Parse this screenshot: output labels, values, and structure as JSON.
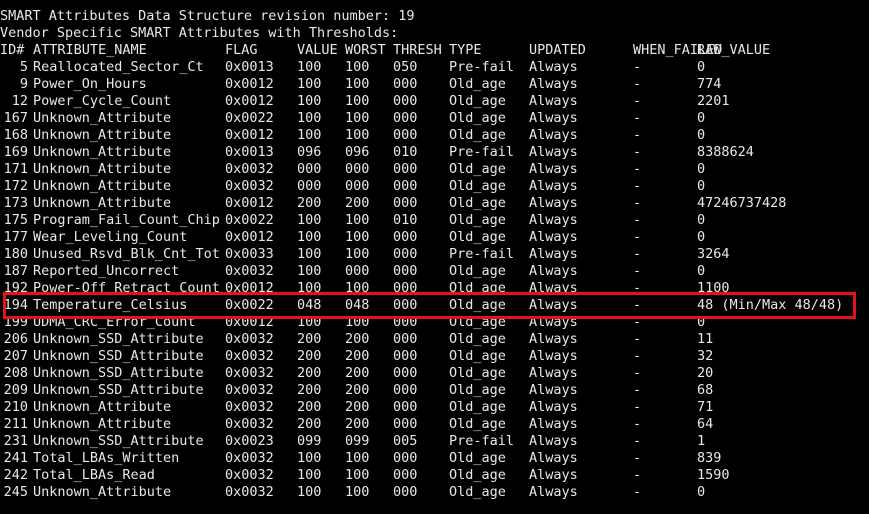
{
  "header_lines": [
    "SMART Attributes Data Structure revision number: 19",
    "Vendor Specific SMART Attributes with Thresholds:"
  ],
  "columns": {
    "id": "ID#",
    "name": "ATTRIBUTE_NAME",
    "flag": "FLAG",
    "value": "VALUE",
    "worst": "WORST",
    "thresh": "THRESH",
    "type": "TYPE",
    "updated": "UPDATED",
    "when_failed": "WHEN_FAILED",
    "raw": "RAW_VALUE"
  },
  "rows": [
    {
      "id": "5",
      "name": "Reallocated_Sector_Ct",
      "flag": "0x0013",
      "value": "100",
      "worst": "100",
      "thresh": "050",
      "type": "Pre-fail",
      "updated": "Always",
      "when_failed": "-",
      "raw": "0"
    },
    {
      "id": "9",
      "name": "Power_On_Hours",
      "flag": "0x0012",
      "value": "100",
      "worst": "100",
      "thresh": "000",
      "type": "Old_age",
      "updated": "Always",
      "when_failed": "-",
      "raw": "774"
    },
    {
      "id": "12",
      "name": "Power_Cycle_Count",
      "flag": "0x0012",
      "value": "100",
      "worst": "100",
      "thresh": "000",
      "type": "Old_age",
      "updated": "Always",
      "when_failed": "-",
      "raw": "2201"
    },
    {
      "id": "167",
      "name": "Unknown_Attribute",
      "flag": "0x0022",
      "value": "100",
      "worst": "100",
      "thresh": "000",
      "type": "Old_age",
      "updated": "Always",
      "when_failed": "-",
      "raw": "0"
    },
    {
      "id": "168",
      "name": "Unknown_Attribute",
      "flag": "0x0012",
      "value": "100",
      "worst": "100",
      "thresh": "000",
      "type": "Old_age",
      "updated": "Always",
      "when_failed": "-",
      "raw": "0"
    },
    {
      "id": "169",
      "name": "Unknown_Attribute",
      "flag": "0x0013",
      "value": "096",
      "worst": "096",
      "thresh": "010",
      "type": "Pre-fail",
      "updated": "Always",
      "when_failed": "-",
      "raw": "8388624"
    },
    {
      "id": "171",
      "name": "Unknown_Attribute",
      "flag": "0x0032",
      "value": "000",
      "worst": "000",
      "thresh": "000",
      "type": "Old_age",
      "updated": "Always",
      "when_failed": "-",
      "raw": "0"
    },
    {
      "id": "172",
      "name": "Unknown_Attribute",
      "flag": "0x0032",
      "value": "000",
      "worst": "000",
      "thresh": "000",
      "type": "Old_age",
      "updated": "Always",
      "when_failed": "-",
      "raw": "0"
    },
    {
      "id": "173",
      "name": "Unknown_Attribute",
      "flag": "0x0012",
      "value": "200",
      "worst": "200",
      "thresh": "000",
      "type": "Old_age",
      "updated": "Always",
      "when_failed": "-",
      "raw": "47246737428"
    },
    {
      "id": "175",
      "name": "Program_Fail_Count_Chip",
      "flag": "0x0022",
      "value": "100",
      "worst": "100",
      "thresh": "010",
      "type": "Old_age",
      "updated": "Always",
      "when_failed": "-",
      "raw": "0"
    },
    {
      "id": "177",
      "name": "Wear_Leveling_Count",
      "flag": "0x0012",
      "value": "100",
      "worst": "100",
      "thresh": "000",
      "type": "Old_age",
      "updated": "Always",
      "when_failed": "-",
      "raw": "0"
    },
    {
      "id": "180",
      "name": "Unused_Rsvd_Blk_Cnt_Tot",
      "flag": "0x0033",
      "value": "100",
      "worst": "100",
      "thresh": "000",
      "type": "Pre-fail",
      "updated": "Always",
      "when_failed": "-",
      "raw": "3264"
    },
    {
      "id": "187",
      "name": "Reported_Uncorrect",
      "flag": "0x0032",
      "value": "100",
      "worst": "000",
      "thresh": "000",
      "type": "Old_age",
      "updated": "Always",
      "when_failed": "-",
      "raw": "0"
    },
    {
      "id": "192",
      "name": "Power-Off_Retract_Count",
      "flag": "0x0012",
      "value": "100",
      "worst": "100",
      "thresh": "000",
      "type": "Old_age",
      "updated": "Always",
      "when_failed": "-",
      "raw": "1100"
    },
    {
      "id": "194",
      "name": "Temperature_Celsius",
      "flag": "0x0022",
      "value": "048",
      "worst": "048",
      "thresh": "000",
      "type": "Old_age",
      "updated": "Always",
      "when_failed": "-",
      "raw": "48 (Min/Max 48/48)"
    },
    {
      "id": "199",
      "name": "UDMA_CRC_Error_Count",
      "flag": "0x0012",
      "value": "100",
      "worst": "100",
      "thresh": "000",
      "type": "Old_age",
      "updated": "Always",
      "when_failed": "-",
      "raw": "0"
    },
    {
      "id": "206",
      "name": "Unknown_SSD_Attribute",
      "flag": "0x0032",
      "value": "200",
      "worst": "200",
      "thresh": "000",
      "type": "Old_age",
      "updated": "Always",
      "when_failed": "-",
      "raw": "11"
    },
    {
      "id": "207",
      "name": "Unknown_SSD_Attribute",
      "flag": "0x0032",
      "value": "200",
      "worst": "200",
      "thresh": "000",
      "type": "Old_age",
      "updated": "Always",
      "when_failed": "-",
      "raw": "32"
    },
    {
      "id": "208",
      "name": "Unknown_SSD_Attribute",
      "flag": "0x0032",
      "value": "200",
      "worst": "200",
      "thresh": "000",
      "type": "Old_age",
      "updated": "Always",
      "when_failed": "-",
      "raw": "20"
    },
    {
      "id": "209",
      "name": "Unknown_SSD_Attribute",
      "flag": "0x0032",
      "value": "200",
      "worst": "200",
      "thresh": "000",
      "type": "Old_age",
      "updated": "Always",
      "when_failed": "-",
      "raw": "68"
    },
    {
      "id": "210",
      "name": "Unknown_Attribute",
      "flag": "0x0032",
      "value": "200",
      "worst": "200",
      "thresh": "000",
      "type": "Old_age",
      "updated": "Always",
      "when_failed": "-",
      "raw": "71"
    },
    {
      "id": "211",
      "name": "Unknown_Attribute",
      "flag": "0x0032",
      "value": "200",
      "worst": "200",
      "thresh": "000",
      "type": "Old_age",
      "updated": "Always",
      "when_failed": "-",
      "raw": "64"
    },
    {
      "id": "231",
      "name": "Unknown_SSD_Attribute",
      "flag": "0x0023",
      "value": "099",
      "worst": "099",
      "thresh": "005",
      "type": "Pre-fail",
      "updated": "Always",
      "when_failed": "-",
      "raw": "1"
    },
    {
      "id": "241",
      "name": "Total_LBAs_Written",
      "flag": "0x0032",
      "value": "100",
      "worst": "100",
      "thresh": "000",
      "type": "Old_age",
      "updated": "Always",
      "when_failed": "-",
      "raw": "839"
    },
    {
      "id": "242",
      "name": "Total_LBAs_Read",
      "flag": "0x0032",
      "value": "100",
      "worst": "100",
      "thresh": "000",
      "type": "Old_age",
      "updated": "Always",
      "when_failed": "-",
      "raw": "1590"
    },
    {
      "id": "245",
      "name": "Unknown_Attribute",
      "flag": "0x0032",
      "value": "100",
      "worst": "100",
      "thresh": "000",
      "type": "Old_age",
      "updated": "Always",
      "when_failed": "-",
      "raw": "0"
    }
  ],
  "highlight": {
    "row_id": "194",
    "color": "#e0141a"
  },
  "colors": {
    "background": "#000000",
    "text": "#e8e8e8"
  }
}
